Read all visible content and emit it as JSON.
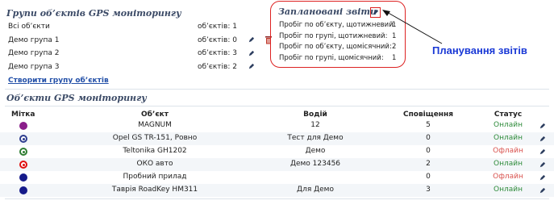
{
  "groups": {
    "title": "Групи об’єктів GPS моніторингу",
    "count_label": "об’єктів:",
    "items": [
      {
        "name": "Всі об’єкти",
        "count": "1",
        "editable": false,
        "deletable": false
      },
      {
        "name": "Демо група 1",
        "count": "0",
        "editable": true,
        "deletable": true
      },
      {
        "name": "Демо група 2",
        "count": "3",
        "editable": true,
        "deletable": false
      },
      {
        "name": "Демо група 3",
        "count": "2",
        "editable": true,
        "deletable": false
      }
    ],
    "create_link": "Створити групу об’єктів"
  },
  "scheduled": {
    "title": "Заплановані звіти",
    "items": [
      {
        "label": "Пробіг по об’єкту, щотижневий:",
        "count": "1"
      },
      {
        "label": "Пробіг по групі, щотижневий:",
        "count": "1"
      },
      {
        "label": "Пробіг по об’єкту, щомісячний:",
        "count": "2"
      },
      {
        "label": "Пробіг по групі, щомісячний:",
        "count": "1"
      }
    ]
  },
  "callout": {
    "label": "Планування звітів",
    "color": "#1a39d6"
  },
  "objects": {
    "title": "Об’єкти GPS моніторингу",
    "columns": {
      "marker": "Мітка",
      "object": "Об’єкт",
      "driver": "Водій",
      "alerts": "Сповіщення",
      "status": "Статус"
    },
    "rows": [
      {
        "marker": "purple-dot",
        "object": "MAGNUM",
        "driver": "12",
        "alerts": "5",
        "status": "Онлайн",
        "online": true
      },
      {
        "marker": "blue-ring",
        "object": "Opel GS TR-151, Ровно",
        "driver": "Тест для Демо",
        "alerts": "0",
        "status": "Онлайн",
        "online": true
      },
      {
        "marker": "green-ring",
        "object": "Teltonika GH1202",
        "driver": "Демо",
        "alerts": "0",
        "status": "Офлайн",
        "online": false
      },
      {
        "marker": "red-ring",
        "object": "ОКО авто",
        "driver": "Демо 123456",
        "alerts": "2",
        "status": "Онлайн",
        "online": true
      },
      {
        "marker": "navy-dot",
        "object": "Пробний прилад",
        "driver": "",
        "alerts": "0",
        "status": "Офлайн",
        "online": false
      },
      {
        "marker": "navy-dot",
        "object": "Таврія RoadKey HM311",
        "driver": "Для Демо",
        "alerts": "3",
        "status": "Онлайн",
        "online": true
      }
    ]
  },
  "colors": {
    "online": "#2e8b3a",
    "offline": "#d9534f",
    "link": "#2350a8",
    "highlight": "#dd2222"
  }
}
